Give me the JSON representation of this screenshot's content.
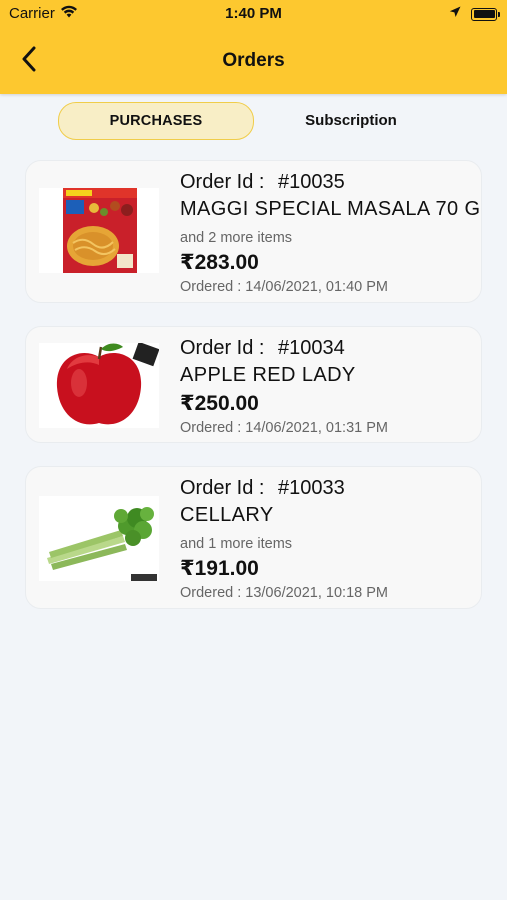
{
  "status_bar": {
    "carrier": "Carrier",
    "time": "1:40 PM",
    "icons": [
      "wifi-icon",
      "location-arrow-icon",
      "battery-icon"
    ]
  },
  "nav": {
    "title": "Orders",
    "back_icon": "chevron-left-icon"
  },
  "tabs": [
    {
      "label": "PURCHASES",
      "active": true
    },
    {
      "label": "Subscription",
      "active": false
    }
  ],
  "orders": [
    {
      "order_id_label": "Order Id :",
      "order_id": "#10035",
      "name": "MAGGI SPECIAL MASALA 70 G",
      "more_items": "and 2 more items",
      "price": "₹283.00",
      "ordered": "Ordered : 14/06/2021, 01:40 PM",
      "image": "maggi-pack-image"
    },
    {
      "order_id_label": "Order Id :",
      "order_id": "#10034",
      "name": "APPLE RED LADY",
      "more_items": "",
      "price": "₹250.00",
      "ordered": "Ordered : 14/06/2021, 01:31 PM",
      "image": "red-apple-image"
    },
    {
      "order_id_label": "Order Id :",
      "order_id": "#10033",
      "name": "CELLARY",
      "more_items": "and 1 more items",
      "price": "₹191.00",
      "ordered": "Ordered : 13/06/2021, 10:18 PM",
      "image": "celery-image"
    }
  ],
  "colors": {
    "header": "#fdc82f",
    "active_tab_bg": "#f8eec6",
    "background": "#f2f5f9"
  }
}
